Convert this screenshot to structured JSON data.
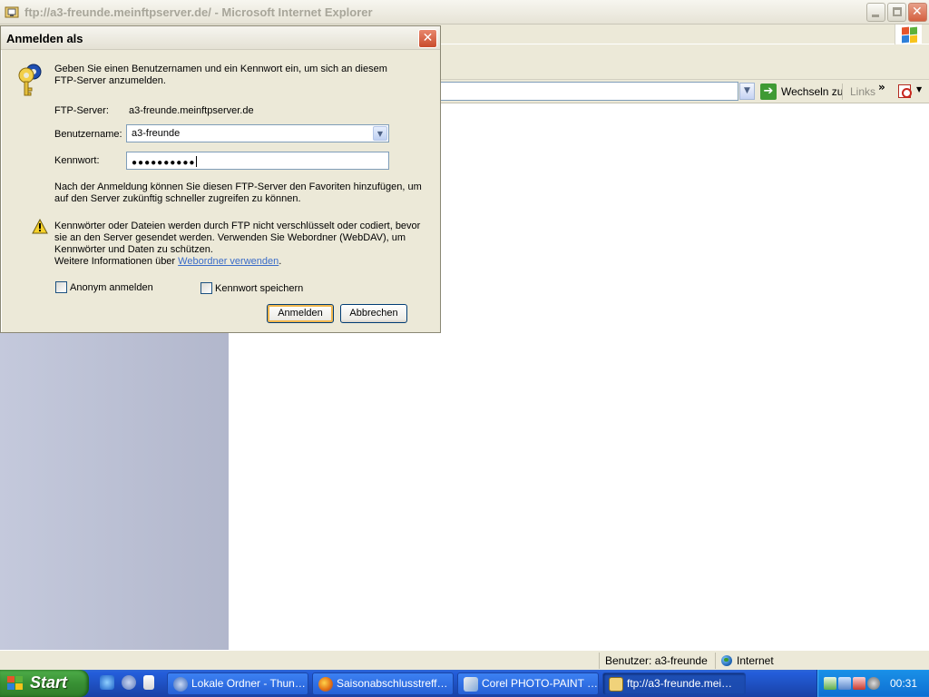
{
  "window": {
    "title": "ftp://a3-freunde.meinftpserver.de/ - Microsoft Internet Explorer",
    "minimize": "minimize",
    "maximize": "maximize",
    "close": "close"
  },
  "addressbar": {
    "go_label": "Wechseln zu",
    "links_label": "Links",
    "more": "»"
  },
  "statusbar": {
    "user": "Benutzer: a3-freunde",
    "zone": "Internet"
  },
  "dialog": {
    "title": "Anmelden als",
    "intro_line1": "Geben Sie einen Benutzernamen und ein Kennwort ein, um sich an diesem",
    "intro_line2": "FTP-Server anzumelden.",
    "server_label": "FTP-Server:",
    "server_value": "a3-freunde.meinftpserver.de",
    "username_label": "Benutzername:",
    "username_value": "a3-freunde",
    "password_label": "Kennwort:",
    "password_value": "●●●●●●●●●●",
    "favorites_line1": "Nach der Anmeldung können Sie diesen FTP-Server den Favoriten hinzufügen, um",
    "favorites_line2": "auf den Server zukünftig schneller zugreifen zu können.",
    "warning_line1": "Kennwörter oder Dateien werden durch FTP nicht verschlüsselt oder codiert, bevor",
    "warning_line2": "sie an den Server gesendet werden. Verwenden Sie Webordner (WebDAV), um",
    "warning_line3": "Kennwörter und Daten zu schützen.",
    "more_info_prefix": "Weitere Informationen über ",
    "more_info_link": "Webordner verwenden",
    "more_info_suffix": ".",
    "anonymous_label": "Anonym anmelden",
    "anonymous_checked": false,
    "save_password_label": "Kennwort speichern",
    "save_password_checked": false,
    "login_button": "Anmelden",
    "cancel_button": "Abbrechen"
  },
  "taskbar": {
    "start_label": "Start",
    "tasks": [
      {
        "label": "Lokale Ordner - Thun…",
        "icon": "thunderbird-icon",
        "active": false
      },
      {
        "label": "Saisonabschlusstreff…",
        "icon": "firefox-icon",
        "active": false
      },
      {
        "label": "Corel PHOTO-PAINT …",
        "icon": "corel-icon",
        "active": false
      },
      {
        "label": "ftp://a3-freunde.mei…",
        "icon": "ftp-folder-icon",
        "active": true
      }
    ],
    "clock": "00:31"
  },
  "colors": {
    "taskbar_blue": "#245edb",
    "start_green": "#389034",
    "dialog_bg": "#ece9d8",
    "link": "#3a6cc8"
  }
}
